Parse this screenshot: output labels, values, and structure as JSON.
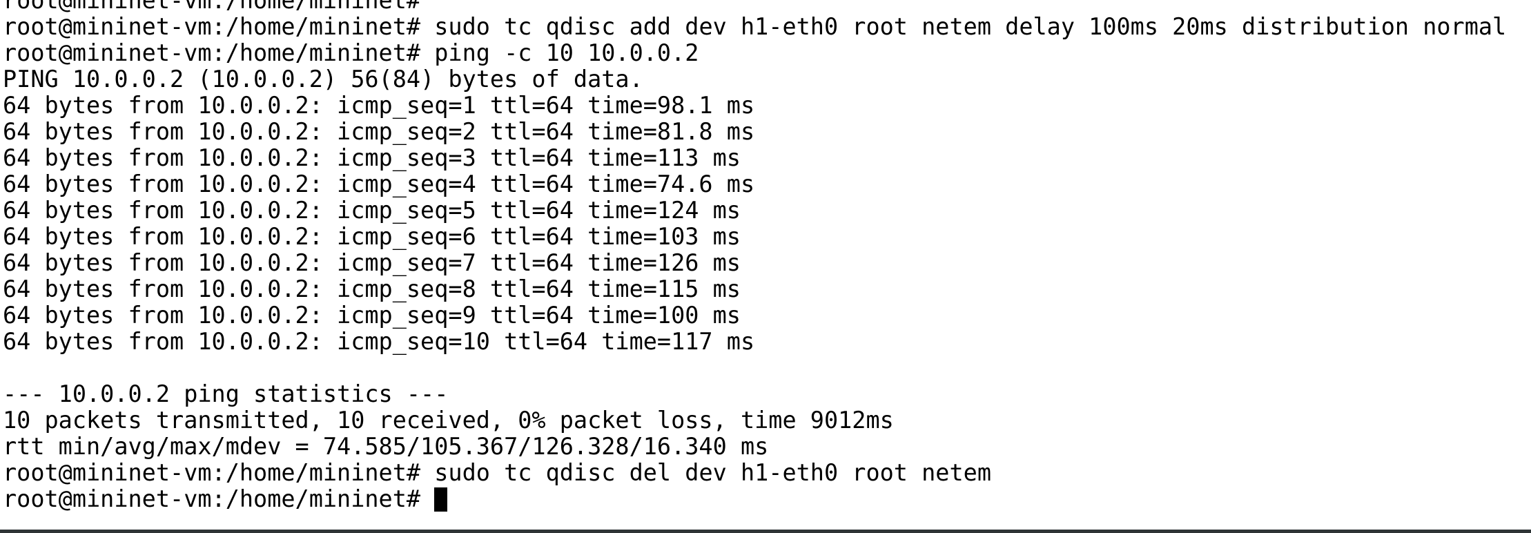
{
  "terminal": {
    "prompt": "root@mininet-vm:/home/mininet#",
    "lines": [
      {
        "type": "prompt",
        "command": ""
      },
      {
        "type": "prompt",
        "command": "sudo tc qdisc add dev h1-eth0 root netem delay 100ms 20ms distribution normal"
      },
      {
        "type": "prompt",
        "command": "ping -c 10 10.0.0.2"
      },
      {
        "type": "output",
        "text": "PING 10.0.0.2 (10.0.0.2) 56(84) bytes of data."
      },
      {
        "type": "output",
        "text": "64 bytes from 10.0.0.2: icmp_seq=1 ttl=64 time=98.1 ms"
      },
      {
        "type": "output",
        "text": "64 bytes from 10.0.0.2: icmp_seq=2 ttl=64 time=81.8 ms"
      },
      {
        "type": "output",
        "text": "64 bytes from 10.0.0.2: icmp_seq=3 ttl=64 time=113 ms"
      },
      {
        "type": "output",
        "text": "64 bytes from 10.0.0.2: icmp_seq=4 ttl=64 time=74.6 ms"
      },
      {
        "type": "output",
        "text": "64 bytes from 10.0.0.2: icmp_seq=5 ttl=64 time=124 ms"
      },
      {
        "type": "output",
        "text": "64 bytes from 10.0.0.2: icmp_seq=6 ttl=64 time=103 ms"
      },
      {
        "type": "output",
        "text": "64 bytes from 10.0.0.2: icmp_seq=7 ttl=64 time=126 ms"
      },
      {
        "type": "output",
        "text": "64 bytes from 10.0.0.2: icmp_seq=8 ttl=64 time=115 ms"
      },
      {
        "type": "output",
        "text": "64 bytes from 10.0.0.2: icmp_seq=9 ttl=64 time=100 ms"
      },
      {
        "type": "output",
        "text": "64 bytes from 10.0.0.2: icmp_seq=10 ttl=64 time=117 ms"
      },
      {
        "type": "output",
        "text": ""
      },
      {
        "type": "output",
        "text": "--- 10.0.0.2 ping statistics ---"
      },
      {
        "type": "output",
        "text": "10 packets transmitted, 10 received, 0% packet loss, time 9012ms"
      },
      {
        "type": "output",
        "text": "rtt min/avg/max/mdev = 74.585/105.367/126.328/16.340 ms"
      },
      {
        "type": "prompt",
        "command": "sudo tc qdisc del dev h1-eth0 root netem"
      },
      {
        "type": "prompt",
        "command": "",
        "cursor": true
      }
    ]
  },
  "colors": {
    "background": "#ffffff",
    "foreground": "#000000",
    "cursor": "#000000",
    "bottom_bar": "#2e3436"
  }
}
